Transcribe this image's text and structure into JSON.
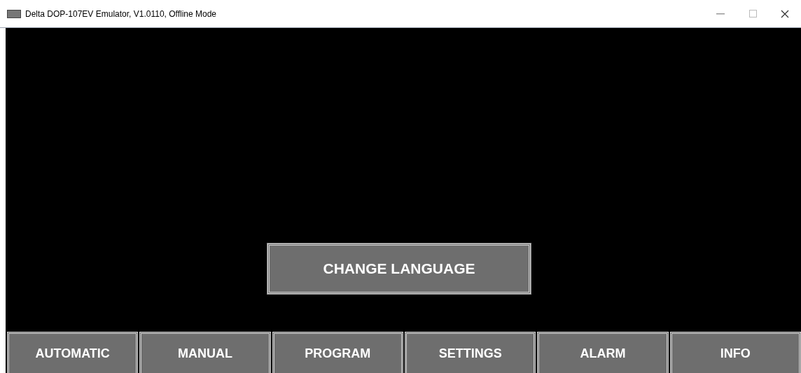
{
  "window": {
    "title": "Delta DOP-107EV Emulator, V1.0110, Offline Mode"
  },
  "screen": {
    "button": "CHANGE LANGUAGE"
  },
  "nav_buttons": [
    "AUTOMATIC",
    "MANUAL",
    "PROGRAM",
    "SETTINGS",
    "ALARM",
    "INFO"
  ]
}
